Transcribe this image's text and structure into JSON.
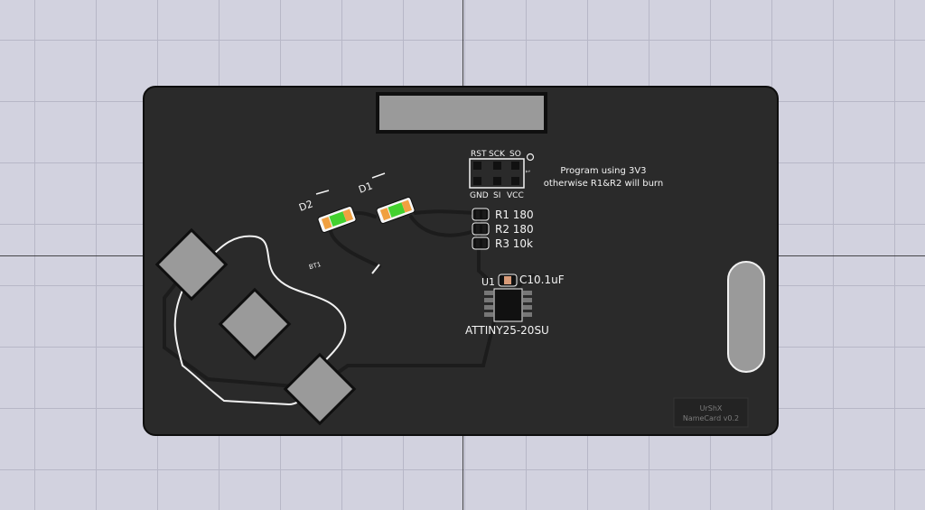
{
  "canvas": {
    "background": "#d2d2df",
    "grid_color": "#b7b7c7",
    "board_color": "#2a2a2a",
    "pad_color": "#9a9a9a",
    "led_green": "#43d12f",
    "led_orange": "#f0a040"
  },
  "header_labels": {
    "top": [
      "RST",
      "SCK",
      "SO"
    ],
    "bottom": [
      "GND",
      "SI",
      "VCC"
    ],
    "pin1_marker": "1"
  },
  "note": {
    "line1": "Program using 3V3",
    "line2": "otherwise R1&R2 will burn"
  },
  "components": {
    "d2": "D2",
    "d1": "D1",
    "r1": "R1 180",
    "r2": "R2 180",
    "r3": "R3 10k",
    "u1": "U1",
    "c1": "C10.1uF",
    "mcu": "ATTINY25-20SU",
    "bt1": "BT1"
  },
  "board_tag": {
    "line1": "UrShX",
    "line2": "NameCard v0.2"
  }
}
